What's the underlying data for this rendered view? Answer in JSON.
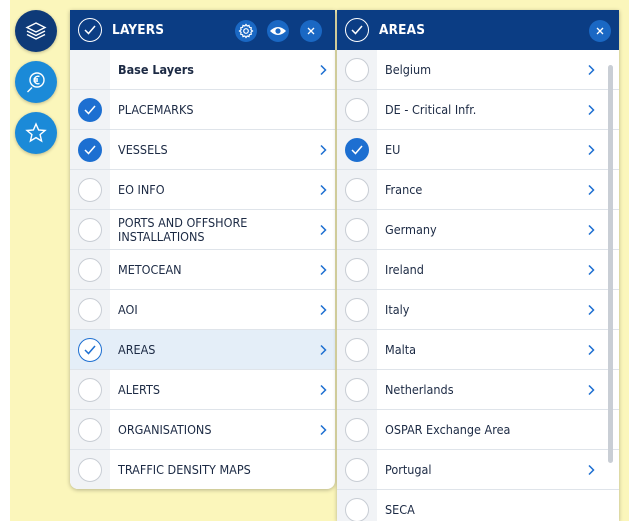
{
  "toolbar": {
    "buttons": [
      {
        "name": "layers",
        "icon": "layers-icon",
        "active": true
      },
      {
        "name": "euro-search",
        "icon": "euro-search-icon",
        "active": false
      },
      {
        "name": "favorites",
        "icon": "star-icon",
        "active": false
      }
    ]
  },
  "layers_panel": {
    "title": "LAYERS",
    "items": [
      {
        "label": "Base Layers",
        "state": "none",
        "bold": true,
        "chevron": true
      },
      {
        "label": "PLACEMARKS",
        "state": "checked",
        "chevron": false
      },
      {
        "label": "VESSELS",
        "state": "checked",
        "chevron": true
      },
      {
        "label": "EO INFO",
        "state": "unchecked",
        "chevron": true
      },
      {
        "label": "PORTS AND OFFSHORE INSTALLATIONS",
        "state": "unchecked",
        "chevron": true
      },
      {
        "label": "METOCEAN",
        "state": "unchecked",
        "chevron": true
      },
      {
        "label": "AOI",
        "state": "unchecked",
        "chevron": true
      },
      {
        "label": "AREAS",
        "state": "outline",
        "chevron": true,
        "highlight": true
      },
      {
        "label": "ALERTS",
        "state": "unchecked",
        "chevron": true
      },
      {
        "label": "ORGANISATIONS",
        "state": "unchecked",
        "chevron": true
      },
      {
        "label": "TRAFFIC DENSITY MAPS",
        "state": "unchecked",
        "chevron": false
      }
    ]
  },
  "areas_panel": {
    "title": "AREAS",
    "items": [
      {
        "label": "Belgium",
        "state": "unchecked",
        "chevron": true
      },
      {
        "label": "DE - Critical Infr.",
        "state": "unchecked",
        "chevron": true
      },
      {
        "label": "EU",
        "state": "checked",
        "chevron": true
      },
      {
        "label": "France",
        "state": "unchecked",
        "chevron": true
      },
      {
        "label": "Germany",
        "state": "unchecked",
        "chevron": true
      },
      {
        "label": "Ireland",
        "state": "unchecked",
        "chevron": true
      },
      {
        "label": "Italy",
        "state": "unchecked",
        "chevron": true
      },
      {
        "label": "Malta",
        "state": "unchecked",
        "chevron": true
      },
      {
        "label": "Netherlands",
        "state": "unchecked",
        "chevron": true
      },
      {
        "label": "OSPAR Exchange Area",
        "state": "unchecked",
        "chevron": false
      },
      {
        "label": "Portugal",
        "state": "unchecked",
        "chevron": true
      },
      {
        "label": "SECA",
        "state": "unchecked",
        "chevron": false
      }
    ]
  },
  "colors": {
    "header": "#0b3d84",
    "accent": "#1d6fd1",
    "toolbar": "#1b8ad8",
    "map_land": "#fbf6bb"
  }
}
